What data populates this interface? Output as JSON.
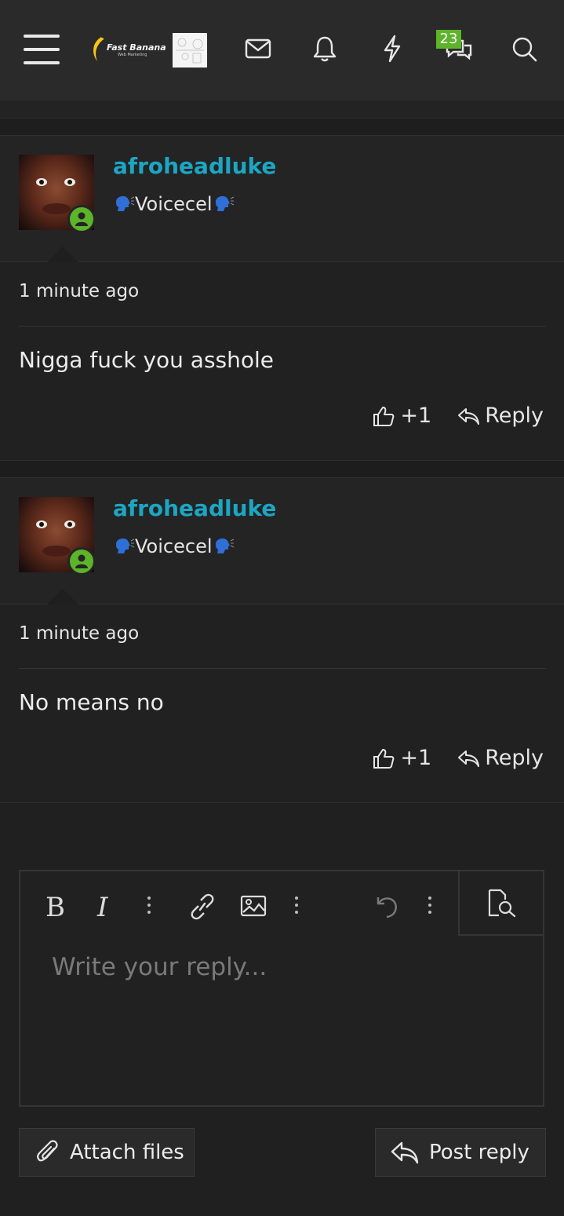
{
  "header": {
    "logo_text": "Fast Banana",
    "logo_subtext": "Web Marketing",
    "alerts_badge": "23",
    "icons": [
      "menu-icon",
      "mail-icon",
      "bell-icon",
      "lightning-icon",
      "chat-icon",
      "search-icon"
    ]
  },
  "posts": [
    {
      "username": "afroheadluke",
      "user_title": "Voicecel",
      "time": "1 minute ago",
      "message": "Nigga fuck you asshole",
      "reactions": "+1",
      "reply_label": "Reply"
    },
    {
      "username": "afroheadluke",
      "user_title": "Voicecel",
      "time": "1 minute ago",
      "message": "No means no",
      "reactions": "+1",
      "reply_label": "Reply"
    }
  ],
  "editor": {
    "placeholder": "Write your reply...",
    "bold_label": "B",
    "italic_label": "I"
  },
  "buttons": {
    "attach": "Attach files",
    "post": "Post reply"
  },
  "colors": {
    "accent": "#1ca6c4",
    "online": "#5db32a",
    "background": "#202020"
  }
}
